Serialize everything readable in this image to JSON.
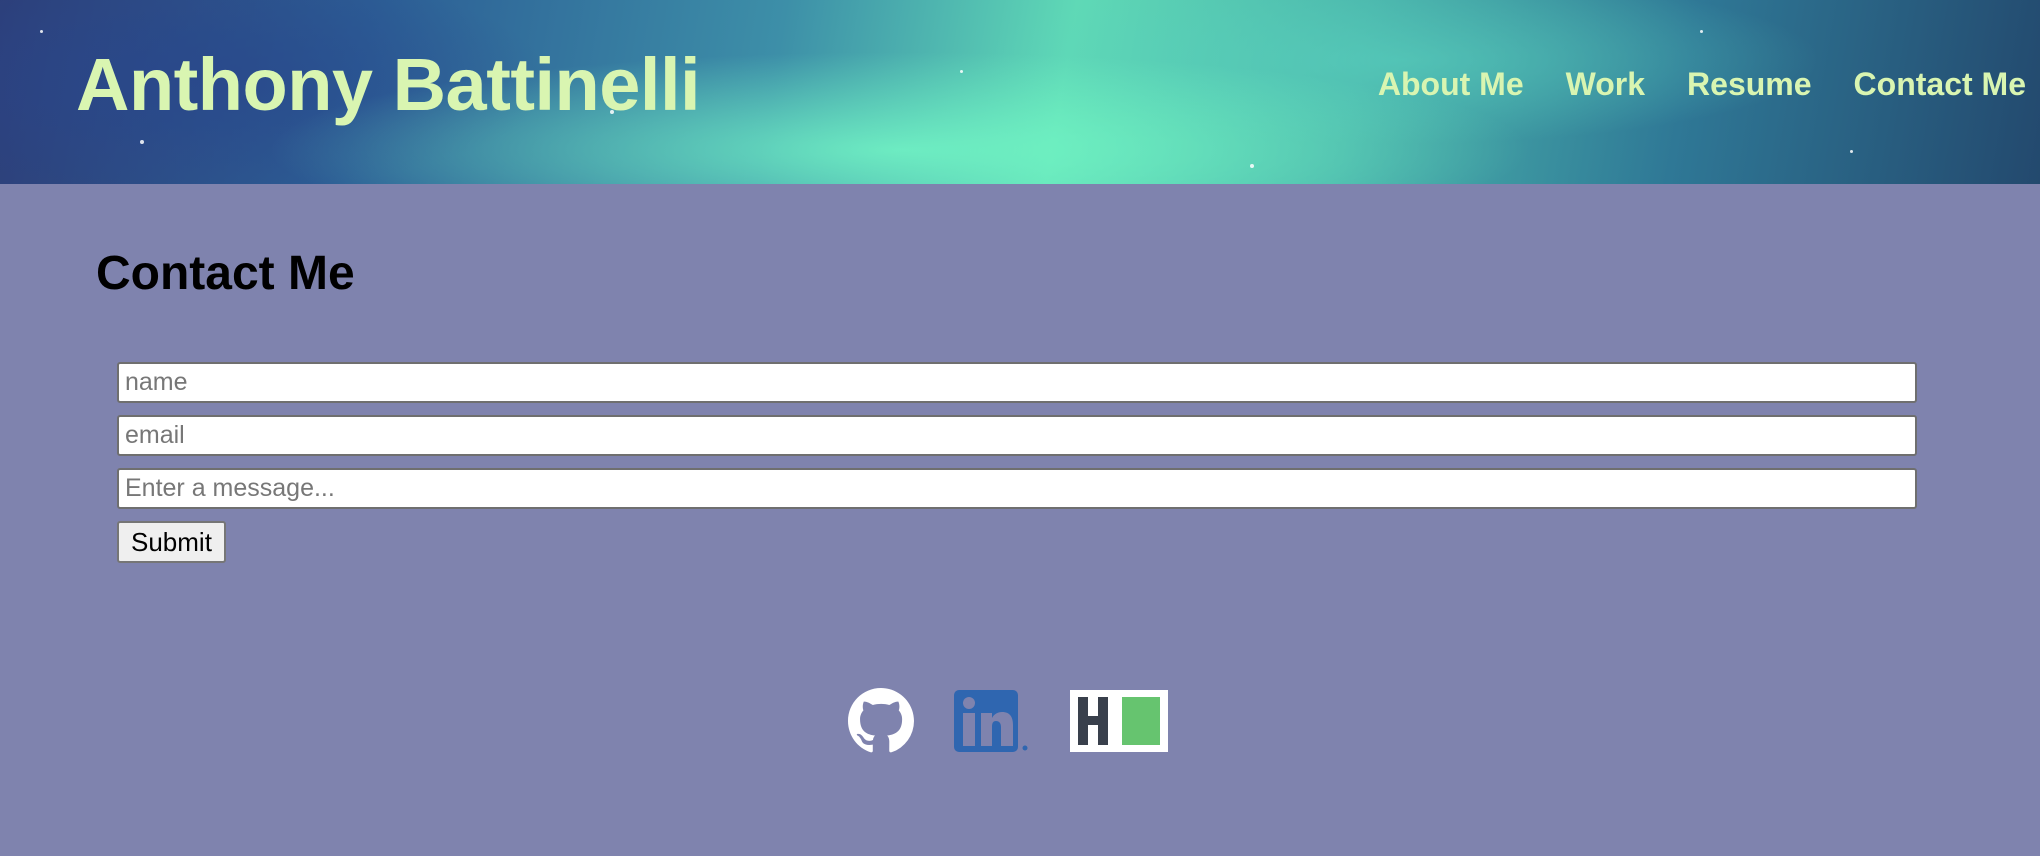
{
  "header": {
    "site_title": "Anthony Battinelli",
    "nav": [
      {
        "label": "About Me"
      },
      {
        "label": "Work"
      },
      {
        "label": "Resume"
      },
      {
        "label": "Contact Me"
      }
    ]
  },
  "contact": {
    "title": "Contact Me",
    "name_placeholder": "name",
    "email_placeholder": "email",
    "message_placeholder": "Enter a message...",
    "submit_label": "Submit"
  },
  "social": {
    "icons": [
      "github-icon",
      "linkedin-icon",
      "hackerrank-icon"
    ]
  },
  "colors": {
    "page_background": "#7f83ae",
    "heading_accent": "#d9f5b1",
    "linkedin_blue": "#2f66b0",
    "hackerrank_green": "#66c46f",
    "hackerrank_dark": "#39404c"
  }
}
